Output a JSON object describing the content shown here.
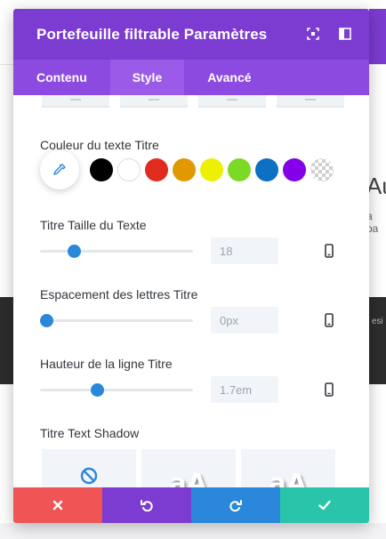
{
  "background": {
    "heading_fragment": "Au",
    "text_fragment": "a pa",
    "dark_text_fragment": "esi"
  },
  "modal": {
    "title": "Portefeuille filtrable Paramètres",
    "header_color": "#7c3bd1",
    "tabs": [
      {
        "label": "Contenu",
        "active": false
      },
      {
        "label": "Style",
        "active": true
      },
      {
        "label": "Avancé",
        "active": false
      }
    ]
  },
  "title_text_color": {
    "label": "Couleur du texte Titre",
    "swatches": [
      {
        "name": "black",
        "color": "#000000"
      },
      {
        "name": "white",
        "color": "#ffffff"
      },
      {
        "name": "red",
        "color": "#e02b20"
      },
      {
        "name": "orange",
        "color": "#e09900"
      },
      {
        "name": "yellow",
        "color": "#edf000"
      },
      {
        "name": "green",
        "color": "#7cda24"
      },
      {
        "name": "blue",
        "color": "#0c71c3"
      },
      {
        "name": "purple",
        "color": "#8300e9"
      },
      {
        "name": "transparent",
        "color": "transparent"
      }
    ]
  },
  "title_font_size": {
    "label": "Titre Taille du Texte",
    "value": "18",
    "slider_fraction": 0.2
  },
  "title_letter_spacing": {
    "label": "Espacement des lettres Titre",
    "value": "0px",
    "slider_fraction": 0.0
  },
  "title_line_height": {
    "label": "Hauteur de la ligne Titre",
    "value": "1.7em",
    "slider_fraction": 0.36
  },
  "title_text_shadow": {
    "label": "Titre Text Shadow",
    "options": [
      {
        "name": "none",
        "icon": "no-icon"
      },
      {
        "name": "preset-1",
        "text": "aA"
      },
      {
        "name": "preset-2",
        "text": "aA"
      }
    ]
  },
  "footer": {
    "buttons": [
      {
        "name": "cancel",
        "icon": "close-icon",
        "color": "#ef5555"
      },
      {
        "name": "undo",
        "icon": "undo-icon",
        "color": "#7c3bd1"
      },
      {
        "name": "redo",
        "icon": "redo-icon",
        "color": "#2b87da"
      },
      {
        "name": "save",
        "icon": "check-icon",
        "color": "#29c4a9"
      }
    ]
  }
}
